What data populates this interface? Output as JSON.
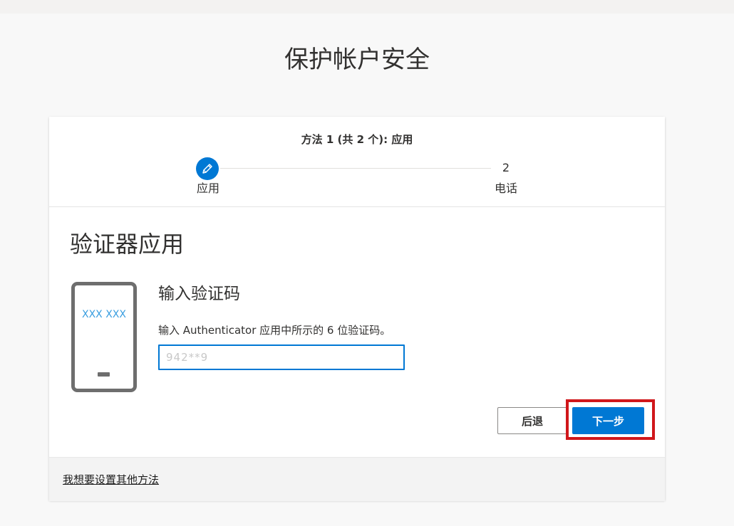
{
  "page": {
    "title": "保护帐户安全"
  },
  "progress": {
    "header": "方法 1 (共 2 个): 应用",
    "steps": [
      {
        "marker": "pencil-icon",
        "label": "应用",
        "state": "current"
      },
      {
        "marker": "2",
        "label": "电话",
        "state": "pending"
      }
    ]
  },
  "method": {
    "title": "验证器应用",
    "phone_screen_text": "XXX XXX",
    "code_heading": "输入验证码",
    "instruction": "输入 Authenticator 应用中所示的 6 位验证码。",
    "code_value": "942**9"
  },
  "actions": {
    "back_label": "后退",
    "next_label": "下一步"
  },
  "footer": {
    "alt_method_link": "我想要设置其他方法"
  },
  "colors": {
    "accent": "#0078d4",
    "highlight": "#d0171b",
    "phone_frame": "#6e6e6e",
    "phone_text": "#3a9ee0"
  }
}
